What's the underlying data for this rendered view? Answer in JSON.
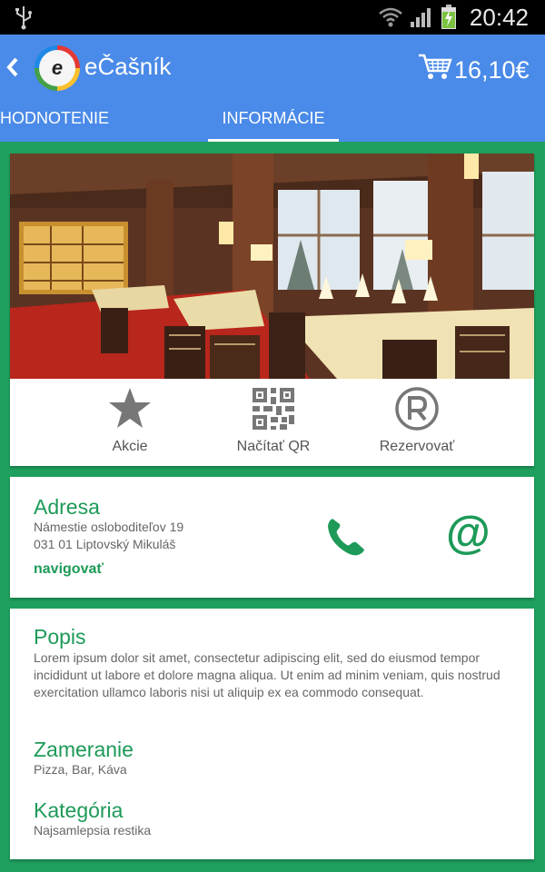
{
  "status_bar": {
    "time": "20:42",
    "icons": [
      "usb-icon",
      "wifi-icon",
      "signal-icon",
      "battery-charging-icon"
    ]
  },
  "app_bar": {
    "title": "eČašník",
    "cart_total": "16,10€",
    "logo_letter": "e"
  },
  "tabs": [
    {
      "label": "HODNOTENIE"
    },
    {
      "label": "INFORMÁCIE",
      "active": true
    }
  ],
  "actions": [
    {
      "label": "Akcie",
      "icon": "star-icon"
    },
    {
      "label": "Načítať QR",
      "icon": "qr-code-icon"
    },
    {
      "label": "Rezervovať",
      "icon": "reserved-icon"
    }
  ],
  "address": {
    "title": "Adresa",
    "line1": "Námestie osloboditeľov 19",
    "line2": "031 01 Liptovský Mikuláš",
    "navigate": "navigovať",
    "email_symbol": "@"
  },
  "description": {
    "title": "Popis",
    "text": "Lorem ipsum dolor sit amet, consectetur adipiscing elit, sed do eiusmod tempor incididunt ut labore et dolore magna aliqua. Ut enim ad minim veniam, quis nostrud exercitation ullamco laboris nisi ut aliquip ex ea commodo consequat.",
    "focus_title": "Zameranie",
    "focus_text": "Pizza, Bar, Káva",
    "category_title": "Kategória",
    "category_text": "Najsamlepsia restika"
  },
  "colors": {
    "accent_green": "#1d9a58",
    "app_bar_blue": "#4a8ae8",
    "background_green": "#1fa05e"
  }
}
